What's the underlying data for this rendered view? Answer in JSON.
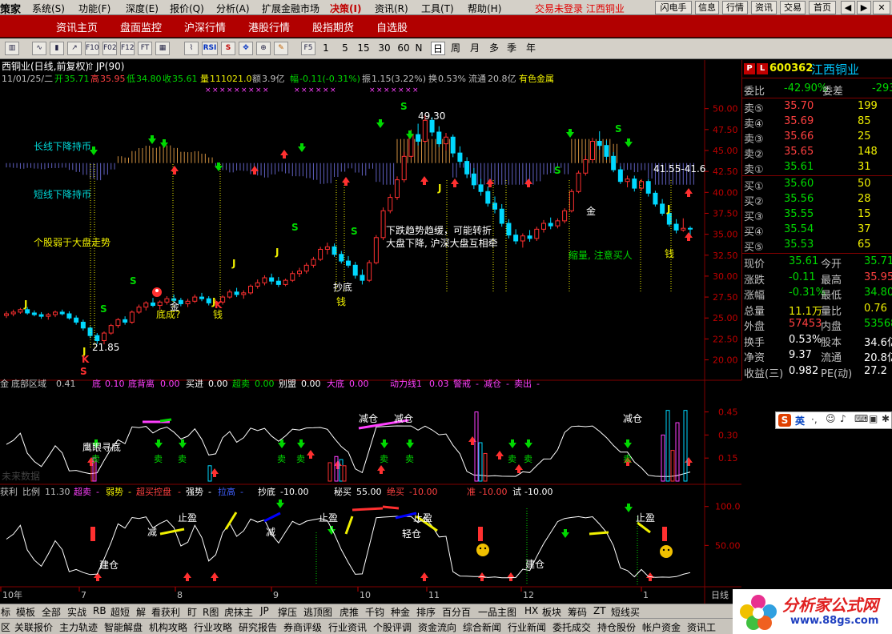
{
  "menubar": {
    "app": "策家",
    "items": [
      "系统(S)",
      "功能(F)",
      "深度(E)",
      "报价(Q)",
      "分析(A)",
      "扩展金融市场",
      "决策(I)",
      "资讯(R)",
      "工具(T)",
      "帮助(H)"
    ],
    "alert": "交易未登录 江西铜业",
    "buttons": [
      "闪电手",
      "信息",
      "行情",
      "资讯",
      "交易",
      "首页"
    ]
  },
  "navbar": [
    "资讯主页",
    "盘面监控",
    "沪深行情",
    "港股行情",
    "股指期货",
    "自选股"
  ],
  "toolbar": {
    "icons": [
      "bar-icon",
      "line-icon",
      "candle-icon",
      "trend-icon",
      "f10-icon",
      "f02-icon",
      "f12-icon",
      "ft-icon",
      "pattern-icon",
      "rsi-icon",
      "s-icon",
      "move-icon",
      "zoom-icon",
      "pen-icon",
      "f5-icon"
    ],
    "icon_labels": [
      "",
      "",
      "",
      "",
      "F10",
      "F02",
      "F12",
      "FT",
      "",
      "RSI",
      "S",
      "",
      "",
      "",
      "F5"
    ],
    "periods": [
      "1",
      "5",
      "15",
      "30",
      "60",
      "N",
      "日",
      "周",
      "月",
      "多",
      "季",
      "年"
    ],
    "selected_period": "日"
  },
  "main_chart": {
    "title": "西铜业(日线,前复权)",
    "indicator": "JP(90)",
    "ohlc_line": {
      "date": "11/01/25/二",
      "open_label": "开",
      "open": "35.71",
      "high_label": "高",
      "high": "35.95",
      "low_label": "低",
      "low": "34.80",
      "close_label": "收",
      "close": "35.61",
      "vol_label": "量",
      "vol": "111021.0",
      "amt_label": "额",
      "amt": "3.9亿",
      "chg_label": "幅",
      "chg": "-0.11(-0.31%)",
      "amp_label": "振",
      "amp": "1.15(3.22%)",
      "turn_label": "换",
      "turn": "0.53%",
      "float_label": "流通",
      "float": "20.8亿",
      "sector": "有色金属"
    },
    "annotations": {
      "long": "长线下降持币",
      "short": "短线下降持币",
      "weak": "个股弱于大盘走势",
      "easing": "下跌趋势趋缓，可能转折",
      "market": "大盘下降, 沪深大盘互相牵",
      "shrink": "缩量, 注意买人",
      "bottom": "底成?",
      "gold1": "金",
      "gold2": "金",
      "chao": "抄底",
      "qian1": "钱",
      "qian2": "钱",
      "qian3": "钱",
      "high_mark": "49.30",
      "low_mark": "21.85",
      "right_marks": "41.55-41.6"
    },
    "yaxis": [
      "50.00",
      "47.50",
      "45.00",
      "42.50",
      "40.00",
      "37.50",
      "35.00",
      "32.50",
      "30.00",
      "27.50",
      "25.00",
      "22.50",
      "20.00"
    ]
  },
  "chart_data": {
    "type": "candlestick",
    "title": "江西铜业(日线,前复权)",
    "ylim": [
      19.0,
      51.5
    ],
    "x": [
      "10年",
      "7",
      "8",
      "9",
      "10",
      "11",
      "12",
      "1"
    ],
    "candles": [
      [
        25.3,
        25.8,
        25.0,
        25.5
      ],
      [
        25.5,
        26.0,
        25.2,
        25.7
      ],
      [
        25.7,
        26.2,
        25.5,
        26.0
      ],
      [
        26.0,
        26.3,
        25.4,
        25.6
      ],
      [
        25.6,
        25.9,
        25.2,
        25.4
      ],
      [
        25.4,
        25.7,
        24.9,
        25.2
      ],
      [
        25.2,
        25.6,
        24.8,
        25.4
      ],
      [
        25.4,
        25.9,
        25.1,
        25.7
      ],
      [
        25.7,
        26.0,
        25.3,
        25.5
      ],
      [
        25.5,
        25.8,
        24.8,
        25.0
      ],
      [
        25.0,
        25.3,
        24.2,
        24.5
      ],
      [
        24.5,
        24.8,
        23.5,
        23.8
      ],
      [
        23.8,
        24.0,
        22.6,
        22.9
      ],
      [
        22.9,
        23.2,
        21.9,
        22.3
      ],
      [
        22.3,
        23.4,
        21.85,
        23.2
      ],
      [
        23.2,
        24.3,
        23.0,
        24.1
      ],
      [
        24.1,
        25.0,
        23.8,
        24.8
      ],
      [
        24.8,
        25.2,
        24.2,
        24.5
      ],
      [
        24.5,
        25.9,
        24.3,
        25.7
      ],
      [
        25.7,
        26.6,
        25.5,
        26.3
      ],
      [
        26.3,
        27.0,
        25.9,
        26.8
      ],
      [
        26.8,
        27.4,
        26.3,
        26.5
      ],
      [
        26.5,
        27.1,
        26.0,
        26.9
      ],
      [
        26.9,
        27.6,
        26.6,
        27.3
      ],
      [
        27.3,
        27.8,
        26.8,
        27.1
      ],
      [
        27.1,
        27.4,
        26.4,
        26.7
      ],
      [
        26.7,
        27.3,
        26.3,
        27.0
      ],
      [
        27.0,
        27.8,
        26.8,
        27.5
      ],
      [
        27.5,
        28.0,
        27.0,
        27.3
      ],
      [
        27.3,
        27.6,
        26.5,
        26.8
      ],
      [
        26.8,
        27.2,
        26.2,
        26.9
      ],
      [
        26.9,
        27.7,
        26.6,
        27.5
      ],
      [
        27.5,
        28.4,
        27.3,
        28.1
      ],
      [
        28.1,
        28.6,
        27.5,
        27.8
      ],
      [
        27.8,
        28.3,
        27.3,
        28.0
      ],
      [
        28.0,
        29.0,
        27.8,
        28.8
      ],
      [
        28.8,
        29.6,
        28.5,
        29.2
      ],
      [
        29.2,
        30.1,
        28.9,
        29.8
      ],
      [
        29.8,
        30.3,
        29.0,
        29.4
      ],
      [
        29.4,
        29.9,
        28.7,
        29.0
      ],
      [
        29.0,
        29.7,
        28.8,
        29.5
      ],
      [
        29.5,
        30.6,
        29.3,
        30.3
      ],
      [
        30.3,
        31.0,
        29.9,
        30.6
      ],
      [
        30.6,
        31.6,
        30.3,
        31.3
      ],
      [
        31.3,
        32.3,
        31.0,
        32.0
      ],
      [
        32.0,
        33.5,
        31.8,
        33.2
      ],
      [
        33.2,
        34.0,
        32.6,
        33.5
      ],
      [
        33.5,
        33.9,
        32.3,
        32.6
      ],
      [
        32.6,
        33.0,
        31.5,
        31.8
      ],
      [
        31.8,
        32.4,
        31.0,
        31.3
      ],
      [
        31.3,
        31.7,
        29.7,
        30.1
      ],
      [
        30.1,
        30.8,
        29.0,
        29.5
      ],
      [
        29.5,
        31.9,
        29.3,
        31.6
      ],
      [
        31.6,
        34.9,
        31.4,
        34.6
      ],
      [
        34.6,
        38.2,
        34.3,
        37.8
      ],
      [
        37.8,
        39.8,
        37.5,
        39.4
      ],
      [
        39.4,
        41.9,
        39.1,
        41.5
      ],
      [
        41.5,
        44.8,
        41.2,
        44.3
      ],
      [
        44.3,
        47.5,
        44.0,
        46.9
      ],
      [
        46.9,
        48.2,
        45.6,
        46.1
      ],
      [
        46.1,
        49.3,
        45.9,
        48.6
      ],
      [
        48.6,
        49.0,
        46.7,
        47.2
      ],
      [
        47.2,
        47.9,
        45.4,
        45.8
      ],
      [
        45.8,
        47.1,
        45.0,
        46.6
      ],
      [
        46.6,
        46.9,
        44.2,
        44.7
      ],
      [
        44.7,
        45.5,
        43.3,
        43.7
      ],
      [
        43.7,
        44.2,
        41.7,
        42.2
      ],
      [
        42.2,
        42.9,
        40.4,
        40.9
      ],
      [
        40.9,
        41.6,
        39.6,
        40.1
      ],
      [
        40.1,
        40.7,
        38.3,
        38.7
      ],
      [
        38.7,
        39.5,
        37.5,
        38.0
      ],
      [
        38.0,
        38.6,
        35.9,
        36.3
      ],
      [
        36.3,
        36.8,
        34.5,
        34.9
      ],
      [
        34.9,
        35.6,
        33.8,
        34.2
      ],
      [
        34.2,
        35.1,
        33.4,
        34.8
      ],
      [
        34.8,
        35.5,
        34.1,
        34.5
      ],
      [
        34.5,
        35.9,
        34.2,
        35.6
      ],
      [
        35.6,
        36.7,
        35.2,
        36.3
      ],
      [
        36.3,
        37.0,
        35.6,
        36.0
      ],
      [
        36.0,
        36.9,
        35.7,
        36.6
      ],
      [
        36.6,
        38.1,
        36.3,
        37.8
      ],
      [
        37.8,
        40.4,
        37.6,
        40.1
      ],
      [
        40.1,
        42.6,
        39.9,
        42.3
      ],
      [
        42.3,
        44.4,
        42.0,
        43.9
      ],
      [
        43.9,
        46.5,
        43.6,
        46.1
      ],
      [
        46.1,
        47.3,
        45.1,
        45.6
      ],
      [
        45.6,
        46.2,
        43.9,
        44.3
      ],
      [
        44.3,
        44.8,
        42.4,
        42.7
      ],
      [
        42.7,
        43.1,
        41.0,
        41.3
      ],
      [
        41.3,
        42.0,
        40.6,
        41.6
      ],
      [
        41.6,
        42.0,
        40.1,
        40.5
      ],
      [
        40.5,
        41.6,
        40.2,
        41.3
      ],
      [
        41.3,
        41.6,
        39.5,
        39.9
      ],
      [
        39.9,
        40.2,
        38.3,
        38.6
      ],
      [
        38.6,
        39.2,
        37.2,
        37.5
      ],
      [
        37.5,
        38.0,
        35.9,
        36.2
      ],
      [
        36.2,
        36.8,
        35.1,
        35.5
      ],
      [
        35.5,
        36.9,
        35.3,
        35.71
      ],
      [
        35.71,
        35.95,
        34.8,
        35.61
      ]
    ]
  },
  "volume_panel": {
    "name": "金",
    "title": "底部区域",
    "values": [
      {
        "label": "",
        "value": "0.41"
      },
      {
        "label": "底",
        "value": "0.10"
      },
      {
        "label": "底背离",
        "value": "0.00"
      },
      {
        "label": "买进",
        "value": "0.00"
      },
      {
        "label": "超卖",
        "value": "0.00"
      },
      {
        "label": "别盟",
        "value": "0.00"
      },
      {
        "label": "大底",
        "value": "0.00"
      },
      {
        "label": "动力线1",
        "value": "0.03"
      },
      {
        "label": "警戒",
        "value": "-"
      },
      {
        "label": "减仓",
        "value": "-"
      },
      {
        "label": "卖出",
        "value": "-"
      }
    ],
    "yaxis": [
      "0.45",
      "0.30",
      "0.15"
    ],
    "notes": {
      "eagle": "鹰眼寻底",
      "reduce1": "减仓",
      "reduce2": "减仓",
      "reduce3": "减仓",
      "sell": "卖",
      "nodata": "未来数据"
    }
  },
  "osc_panel": {
    "name": "获利",
    "values": [
      {
        "label": "比例",
        "value": "11.30"
      },
      {
        "label": "超卖",
        "value": "-"
      },
      {
        "label": "弱势",
        "value": "-"
      },
      {
        "label": "超买控盘",
        "value": "-"
      },
      {
        "label": "强势",
        "value": "-"
      },
      {
        "label": "拉高",
        "value": "-"
      },
      {
        "label": "抄底",
        "value": "-10.00"
      },
      {
        "label": "秘买",
        "value": "55.00"
      },
      {
        "label": "绝买",
        "value": "-10.00"
      },
      {
        "label": "准",
        "value": "-10.00"
      },
      {
        "label": "试",
        "value": "-10.00"
      }
    ],
    "yaxis": [
      "100.0",
      "50.00"
    ],
    "notes": {
      "build1": "建仓",
      "build2": "建仓",
      "profit1": "止盈",
      "profit2": "止盈",
      "profit3": "止盈",
      "reduce": "减",
      "light": "轻仓"
    }
  },
  "xaxis": {
    "labels": [
      "10年",
      "7",
      "8",
      "9",
      "10",
      "11",
      "12",
      "1"
    ],
    "period": "日线"
  },
  "quote": {
    "code": "600362",
    "name": "江西铜业",
    "webi_label": "委比",
    "webi": "-42.90%",
    "weicha_label": "委差",
    "weicha": "-293",
    "sells": [
      {
        "label": "卖⑤",
        "price": "35.70",
        "vol": "199"
      },
      {
        "label": "卖④",
        "price": "35.69",
        "vol": "85"
      },
      {
        "label": "卖③",
        "price": "35.66",
        "vol": "25"
      },
      {
        "label": "卖②",
        "price": "35.65",
        "vol": "148"
      },
      {
        "label": "卖①",
        "price": "35.61",
        "vol": "31"
      }
    ],
    "buys": [
      {
        "label": "买①",
        "price": "35.60",
        "vol": "50"
      },
      {
        "label": "买②",
        "price": "35.56",
        "vol": "28"
      },
      {
        "label": "买③",
        "price": "35.55",
        "vol": "15"
      },
      {
        "label": "买④",
        "price": "35.54",
        "vol": "37"
      },
      {
        "label": "买⑤",
        "price": "35.53",
        "vol": "65"
      }
    ],
    "stats": [
      {
        "l1": "现价",
        "v1": "35.61",
        "c1": "green",
        "l2": "今开",
        "v2": "35.71",
        "c2": "green"
      },
      {
        "l1": "涨跌",
        "v1": "-0.11",
        "c1": "green",
        "l2": "最高",
        "v2": "35.95",
        "c2": "red"
      },
      {
        "l1": "涨幅",
        "v1": "-0.31%",
        "c1": "green",
        "l2": "最低",
        "v2": "34.80",
        "c2": "green"
      },
      {
        "l1": "总量",
        "v1": "11.1万",
        "c1": "yellow",
        "l2": "量比",
        "v2": "0.76",
        "c2": "yellow"
      },
      {
        "l1": "外盘",
        "v1": "57453",
        "c1": "red",
        "l2": "内盘",
        "v2": "53568",
        "c2": "green"
      },
      {
        "l1": "换手",
        "v1": "0.53%",
        "c1": "white",
        "l2": "股本",
        "v2": "34.6亿",
        "c2": "white"
      },
      {
        "l1": "净资",
        "v1": "9.37",
        "c1": "white",
        "l2": "流通",
        "v2": "20.8亿",
        "c2": "white"
      },
      {
        "l1": "收益(三)",
        "v1": "0.982",
        "c1": "white",
        "l2": "PE(动)",
        "v2": "27.2",
        "c2": "white"
      }
    ]
  },
  "ime": {
    "label": "英"
  },
  "tabs1": [
    "标",
    "模板",
    "全部",
    "实战",
    "RB",
    "超短",
    "解",
    "看获利",
    "盯",
    "R图",
    "虎抹主",
    "JP",
    "撑压",
    "逃顶图",
    "虎推",
    "千钧",
    "种金",
    "排序",
    "百分百",
    "一品主图",
    "HX",
    "板块",
    "筹码",
    "ZT",
    "短线买"
  ],
  "tabs2": [
    "区",
    "关联报价",
    "主力轨迹",
    "智能解盘",
    "机构攻略",
    "行业攻略",
    "研究报告",
    "券商评级",
    "行业资讯",
    "个股评调",
    "资金流向",
    "综合新闻",
    "行业新闻",
    "委托成交",
    "持仓股份",
    "帐户资金",
    "资讯工"
  ],
  "watermark": {
    "title": "分析家公式网",
    "url": "www.88gs.com"
  }
}
